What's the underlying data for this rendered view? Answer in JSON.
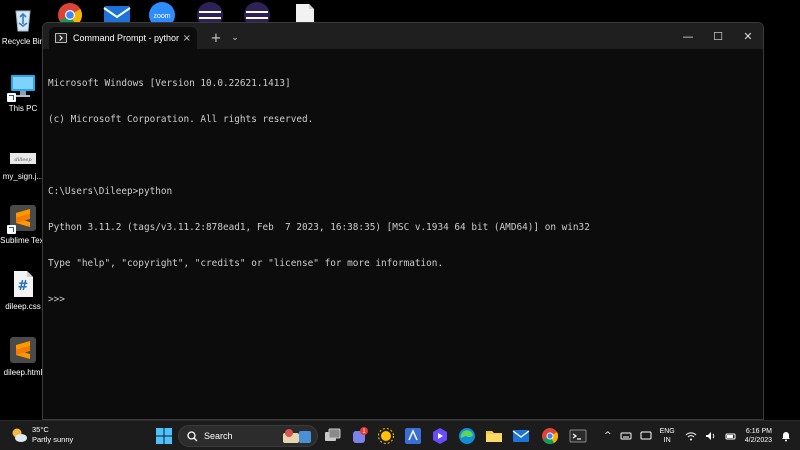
{
  "desktop": {
    "icons": [
      {
        "label": "Recycle Bin"
      },
      {
        "label": "This PC"
      },
      {
        "label": "my_sign.j..."
      },
      {
        "label": "Sublime Text"
      },
      {
        "label": "dileep.css"
      },
      {
        "label": "dileep.html"
      }
    ],
    "thumb_text": "dilleep",
    "css_glyph": "#",
    "zoom_text": "zoom"
  },
  "window": {
    "tab_title": "Command Prompt - python",
    "tab_close": "×",
    "new_tab": "+",
    "dropdown": "⌄",
    "minimize": "—",
    "maximize": "☐",
    "close": "✕",
    "console_lines": [
      "Microsoft Windows [Version 10.0.22621.1413]",
      "(c) Microsoft Corporation. All rights reserved.",
      "",
      "C:\\Users\\Dileep>python",
      "Python 3.11.2 (tags/v3.11.2:878ead1, Feb  7 2023, 16:38:35) [MSC v.1934 64 bit (AMD64)] on win32",
      "Type \"help\", \"copyright\", \"credits\" or \"license\" for more information.",
      ">>>"
    ]
  },
  "taskbar": {
    "weather_temp": "35°C",
    "weather_desc": "Partly sunny",
    "search_label": "Search",
    "teams_badge": "1",
    "lang_line1": "ENG",
    "lang_line2": "IN",
    "time": "6:16 PM",
    "date": "4/2/2023",
    "tray_chevron": "^"
  },
  "colors": {
    "console_bg": "#0c0c0c",
    "console_fg": "#cccccc",
    "taskbar_bg": "#1c1c1c",
    "titlebar_bg": "#1f1f1f"
  }
}
